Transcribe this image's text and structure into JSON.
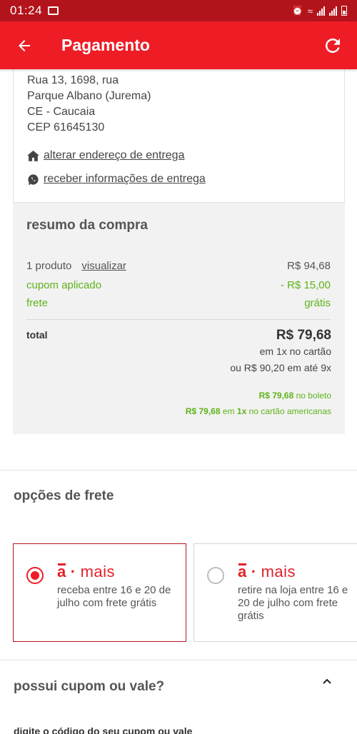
{
  "status_bar": {
    "time": "01:24"
  },
  "app_bar": {
    "title": "Pagamento",
    "back_icon": "arrow-left-icon",
    "refresh_icon": "refresh-icon"
  },
  "address": {
    "street": "Rua 13, 1698, rua",
    "district": "Parque Albano (Jurema)",
    "city_state": "CE - Caucaia",
    "cep": "CEP 61645130",
    "change_address_label": "alterar endereço de entrega",
    "delivery_info_label": "receber informações de entrega"
  },
  "summary": {
    "title": "resumo da compra",
    "product_count_label": "1 produto",
    "view_label": "visualizar",
    "product_value": "R$ 94,68",
    "coupon_label": "cupom aplicado",
    "coupon_value": "- R$ 15,00",
    "shipping_label": "frete",
    "shipping_value": "grátis",
    "total_label": "total",
    "total_value": "R$ 79,68",
    "total_card_text": "em 1x no cartão",
    "installments_text": "ou R$ 90,20 em até 9x",
    "boleto_value": "R$ 79,68",
    "boleto_text": "no boleto",
    "amex_value": "R$ 79,68",
    "amex_em": "em",
    "amex_times": "1x",
    "amex_text": "no cartão americanas"
  },
  "shipping_options": {
    "title": "opções de frete",
    "brand_a": "a",
    "brand_dot": "·",
    "brand_mais": "mais",
    "options": [
      {
        "selected": true,
        "text": "receba entre 16 e 20 de julho com frete grátis"
      },
      {
        "selected": false,
        "line1": "retire na loja entre 16 e",
        "line2": "20 de julho com frete",
        "line3": "grátis"
      }
    ]
  },
  "coupon": {
    "title": "possui cupom ou vale?",
    "hint": "digite o código do seu cupom ou vale"
  },
  "colors": {
    "header_red": "#ee1c25",
    "status_red": "#b3141c",
    "green": "#5fb31b"
  }
}
